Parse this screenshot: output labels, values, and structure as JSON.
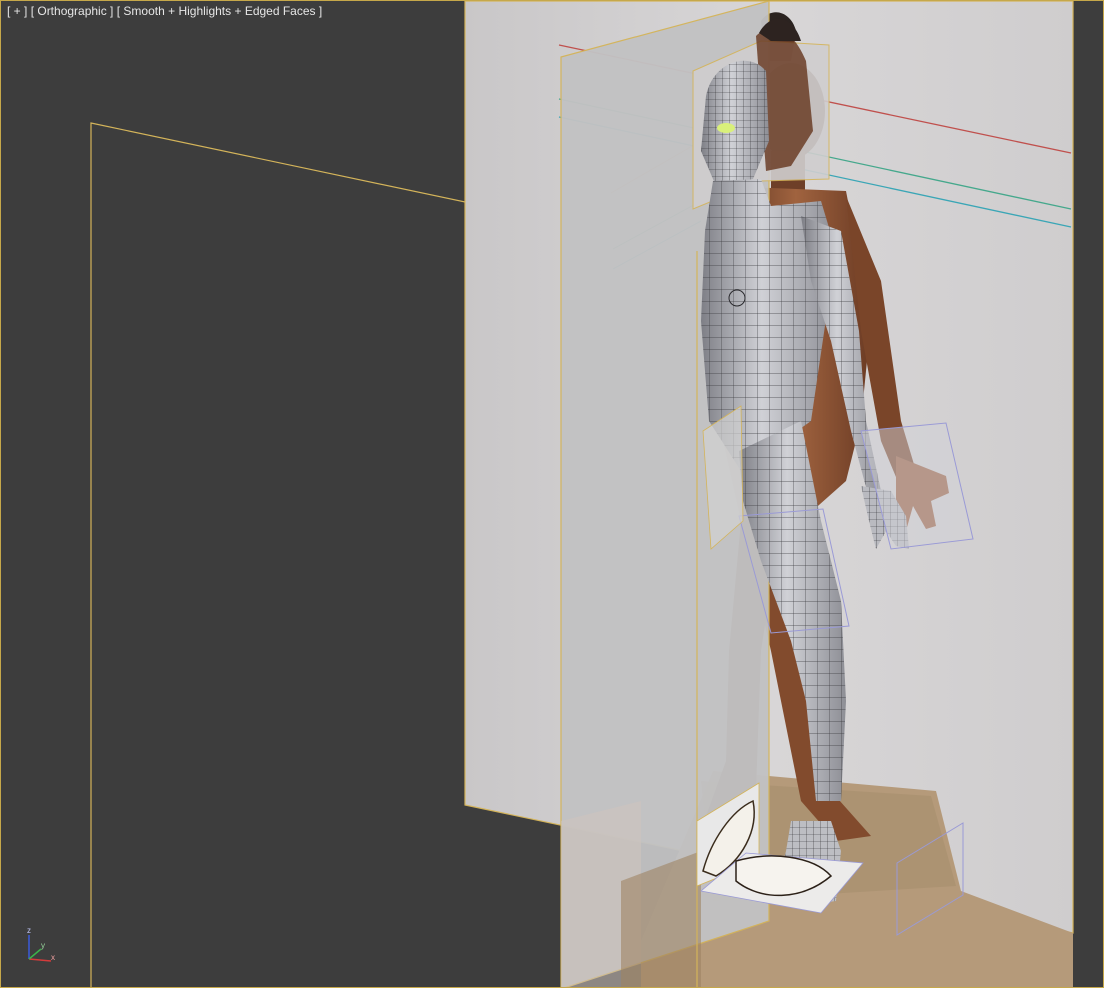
{
  "viewport": {
    "menu_label": "[ + ]",
    "view_label": "[ Orthographic ]",
    "shading_label": "[ Smooth + Highlights + Edged Faces ]"
  },
  "gizmo": {
    "z_label": "z",
    "y_label": "y",
    "x_label": "x"
  },
  "colors": {
    "background": "#3d3d3d",
    "selection_outline": "#d4b45a",
    "plane_gray": "#bdbdbe",
    "mesh_gray": "#9fa0a6",
    "skin": "#8a5436",
    "helper_lines": [
      "#c0504d",
      "#45a88c",
      "#3aa6b6"
    ]
  }
}
